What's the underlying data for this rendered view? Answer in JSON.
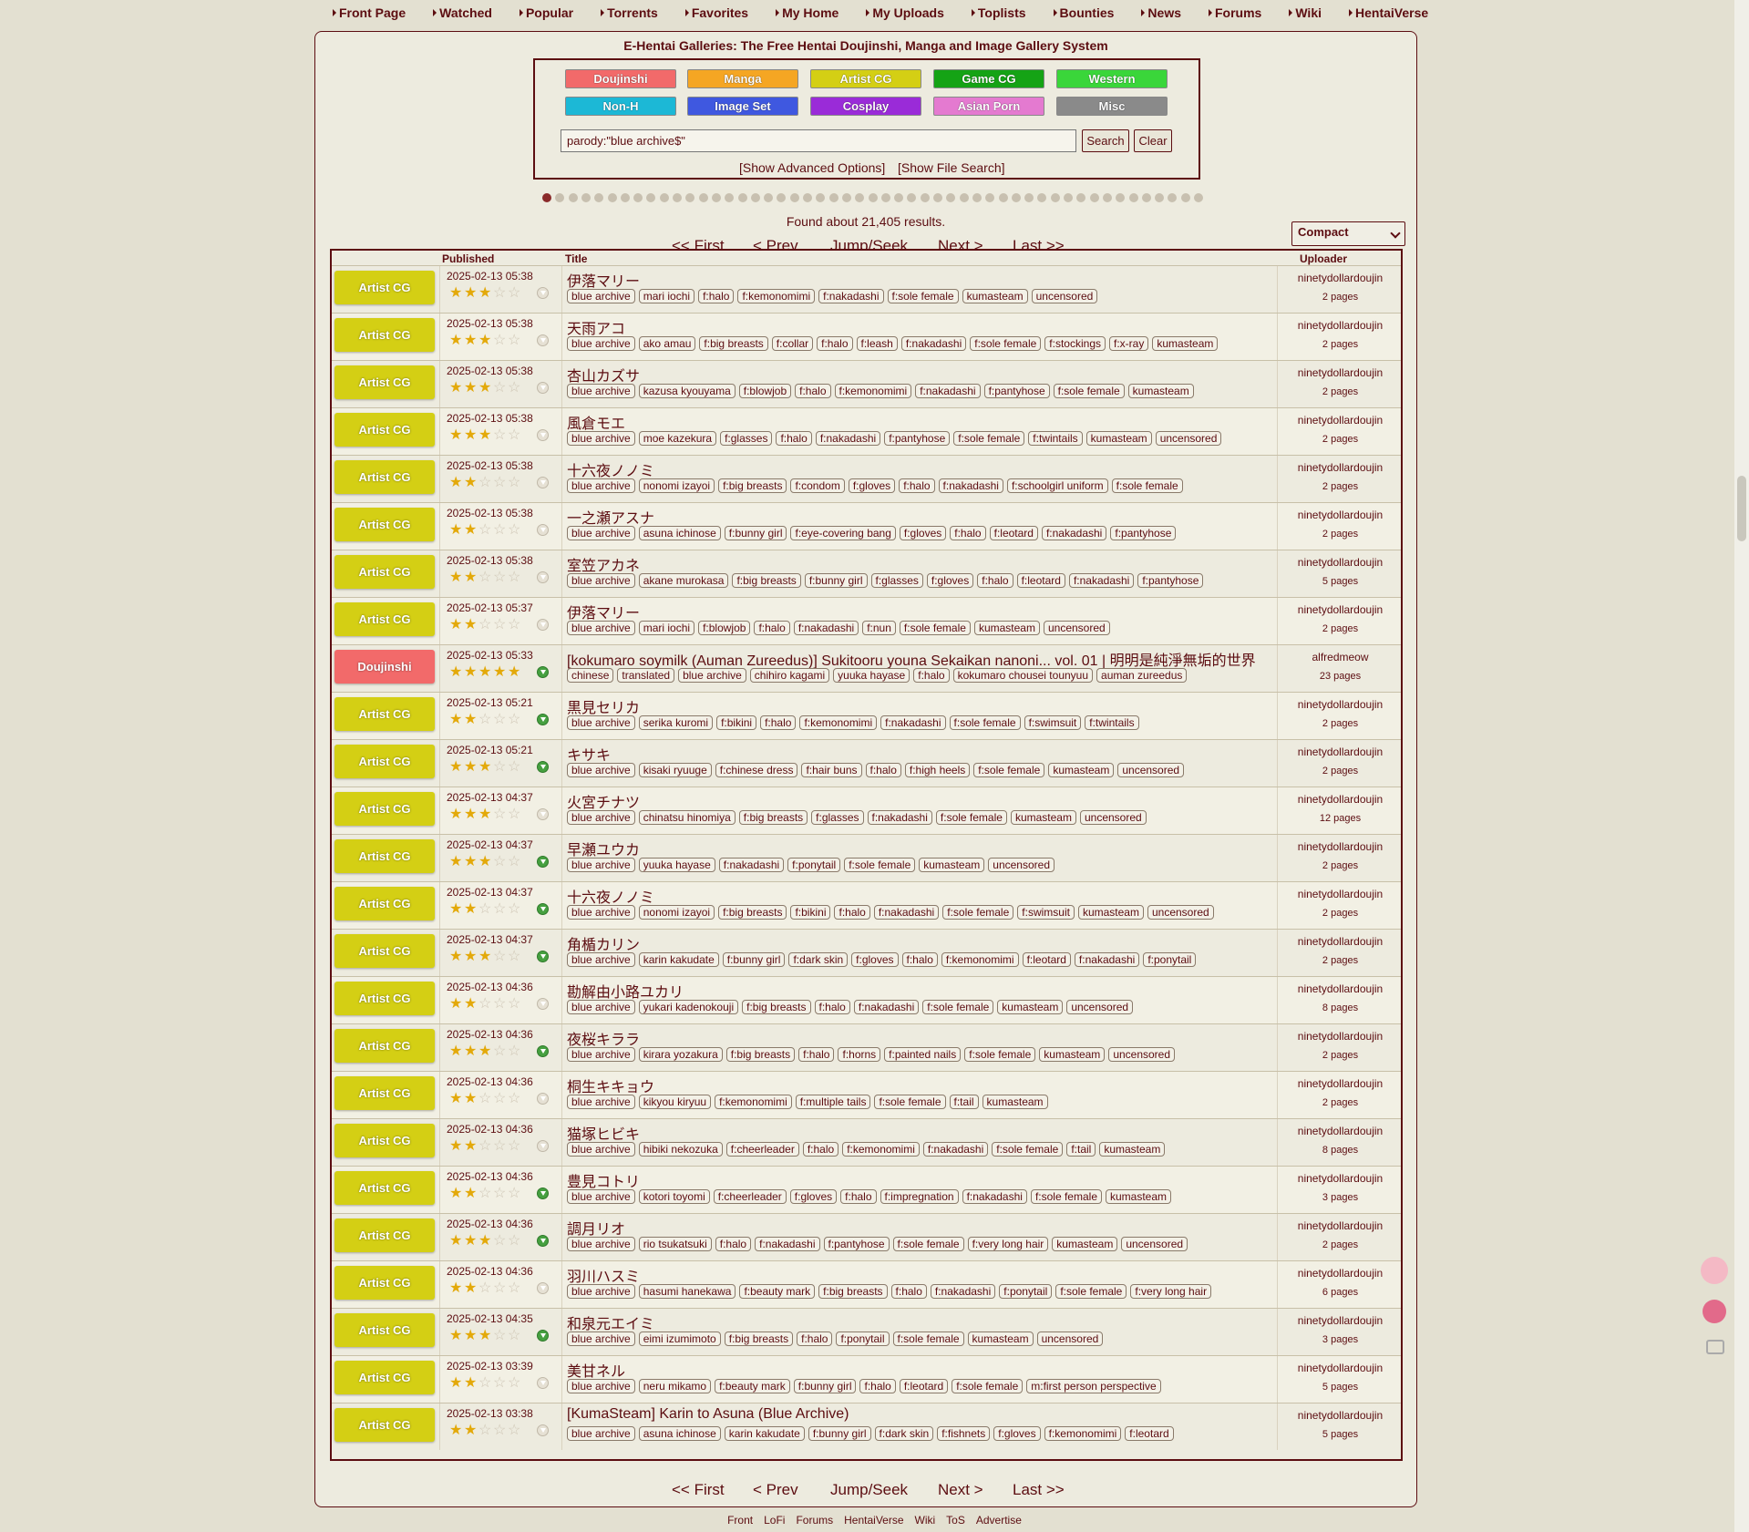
{
  "nav": [
    "Front Page",
    "Watched",
    "Popular",
    "Torrents",
    "Favorites",
    "My Home",
    "My Uploads",
    "Toplists",
    "Bounties",
    "News",
    "Forums",
    "Wiki",
    "HentaiVerse"
  ],
  "site_title": "E-Hentai Galleries: The Free Hentai Doujinshi, Manga and Image Gallery System",
  "categories": [
    {
      "label": "Doujinshi",
      "color": "#f26a6a"
    },
    {
      "label": "Manga",
      "color": "#f5a623"
    },
    {
      "label": "Artist CG",
      "color": "#d4cf14"
    },
    {
      "label": "Game CG",
      "color": "#15a315"
    },
    {
      "label": "Western",
      "color": "#3ad63a"
    },
    {
      "label": "Non-H",
      "color": "#1cb8d6"
    },
    {
      "label": "Image Set",
      "color": "#3f58e0"
    },
    {
      "label": "Cosplay",
      "color": "#9a2bd8"
    },
    {
      "label": "Asian Porn",
      "color": "#e47ad0"
    },
    {
      "label": "Misc",
      "color": "#8a8a8a"
    }
  ],
  "search": {
    "value": "parody:\"blue archive$\"",
    "search_label": "Search",
    "clear_label": "Clear",
    "advanced": "[Show Advanced Options]",
    "file_search": "[Show File Search]"
  },
  "results_text": "Found about 21,405 results.",
  "pager": {
    "first": "<< First",
    "prev": "< Prev",
    "jump": "Jump/Seek",
    "next": "Next >",
    "last": "Last >>"
  },
  "view_mode": "Compact",
  "headers": {
    "published": "Published",
    "title": "Title",
    "uploader": "Uploader"
  },
  "rows": [
    {
      "cat": "Artist CG",
      "date": "2025-02-13 05:38",
      "stars": 2.5,
      "dl": false,
      "title": "伊落マリー",
      "tags": [
        "blue archive",
        "mari iochi",
        "f:halo",
        "f:kemonomimi",
        "f:nakadashi",
        "f:sole female",
        "kumasteam",
        "uncensored"
      ],
      "uploader": "ninetydollardoujin",
      "pages": "2 pages"
    },
    {
      "cat": "Artist CG",
      "date": "2025-02-13 05:38",
      "stars": 2.5,
      "dl": false,
      "title": "天雨アコ",
      "tags": [
        "blue archive",
        "ako amau",
        "f:big breasts",
        "f:collar",
        "f:halo",
        "f:leash",
        "f:nakadashi",
        "f:sole female",
        "f:stockings",
        "f:x-ray",
        "kumasteam"
      ],
      "uploader": "ninetydollardoujin",
      "pages": "2 pages"
    },
    {
      "cat": "Artist CG",
      "date": "2025-02-13 05:38",
      "stars": 2.5,
      "dl": false,
      "title": "杏山カズサ",
      "tags": [
        "blue archive",
        "kazusa kyouyama",
        "f:blowjob",
        "f:halo",
        "f:kemonomimi",
        "f:nakadashi",
        "f:pantyhose",
        "f:sole female",
        "kumasteam"
      ],
      "uploader": "ninetydollardoujin",
      "pages": "2 pages"
    },
    {
      "cat": "Artist CG",
      "date": "2025-02-13 05:38",
      "stars": 2.5,
      "dl": false,
      "title": "風倉モエ",
      "tags": [
        "blue archive",
        "moe kazekura",
        "f:glasses",
        "f:halo",
        "f:nakadashi",
        "f:pantyhose",
        "f:sole female",
        "f:twintails",
        "kumasteam",
        "uncensored"
      ],
      "uploader": "ninetydollardoujin",
      "pages": "2 pages"
    },
    {
      "cat": "Artist CG",
      "date": "2025-02-13 05:38",
      "stars": 2,
      "dl": false,
      "title": "十六夜ノノミ",
      "tags": [
        "blue archive",
        "nonomi izayoi",
        "f:big breasts",
        "f:condom",
        "f:gloves",
        "f:halo",
        "f:nakadashi",
        "f:schoolgirl uniform",
        "f:sole female"
      ],
      "uploader": "ninetydollardoujin",
      "pages": "2 pages"
    },
    {
      "cat": "Artist CG",
      "date": "2025-02-13 05:38",
      "stars": 2,
      "dl": false,
      "title": "一之瀬アスナ",
      "tags": [
        "blue archive",
        "asuna ichinose",
        "f:bunny girl",
        "f:eye-covering bang",
        "f:gloves",
        "f:halo",
        "f:leotard",
        "f:nakadashi",
        "f:pantyhose"
      ],
      "uploader": "ninetydollardoujin",
      "pages": "2 pages"
    },
    {
      "cat": "Artist CG",
      "date": "2025-02-13 05:38",
      "stars": 2,
      "dl": false,
      "title": "室笠アカネ",
      "tags": [
        "blue archive",
        "akane murokasa",
        "f:big breasts",
        "f:bunny girl",
        "f:glasses",
        "f:gloves",
        "f:halo",
        "f:leotard",
        "f:nakadashi",
        "f:pantyhose"
      ],
      "uploader": "ninetydollardoujin",
      "pages": "5 pages"
    },
    {
      "cat": "Artist CG",
      "date": "2025-02-13 05:37",
      "stars": 2,
      "dl": false,
      "title": "伊落マリー",
      "tags": [
        "blue archive",
        "mari iochi",
        "f:blowjob",
        "f:halo",
        "f:nakadashi",
        "f:nun",
        "f:sole female",
        "kumasteam",
        "uncensored"
      ],
      "uploader": "ninetydollardoujin",
      "pages": "2 pages"
    },
    {
      "cat": "Doujinshi",
      "date": "2025-02-13 05:33",
      "stars": 4.5,
      "dl": true,
      "title": "[kokumaro soymilk (Auman Zureedus)] Sukitooru youna Sekaikan nanoni... vol. 01 | 明明是純淨無垢的世界",
      "tags": [
        "chinese",
        "translated",
        "blue archive",
        "chihiro kagami",
        "yuuka hayase",
        "f:halo",
        "kokumaro chousei tounyuu",
        "auman zureedus"
      ],
      "uploader": "alfredmeow",
      "pages": "23 pages"
    },
    {
      "cat": "Artist CG",
      "date": "2025-02-13 05:21",
      "stars": 2,
      "dl": true,
      "title": "黒見セリカ",
      "tags": [
        "blue archive",
        "serika kuromi",
        "f:bikini",
        "f:halo",
        "f:kemonomimi",
        "f:nakadashi",
        "f:sole female",
        "f:swimsuit",
        "f:twintails"
      ],
      "uploader": "ninetydollardoujin",
      "pages": "2 pages"
    },
    {
      "cat": "Artist CG",
      "date": "2025-02-13 05:21",
      "stars": 2.5,
      "dl": true,
      "title": "キサキ",
      "tags": [
        "blue archive",
        "kisaki ryuuge",
        "f:chinese dress",
        "f:hair buns",
        "f:halo",
        "f:high heels",
        "f:sole female",
        "kumasteam",
        "uncensored"
      ],
      "uploader": "ninetydollardoujin",
      "pages": "2 pages"
    },
    {
      "cat": "Artist CG",
      "date": "2025-02-13 04:37",
      "stars": 2.5,
      "dl": false,
      "title": "火宮チナツ",
      "tags": [
        "blue archive",
        "chinatsu hinomiya",
        "f:big breasts",
        "f:glasses",
        "f:nakadashi",
        "f:sole female",
        "kumasteam",
        "uncensored"
      ],
      "uploader": "ninetydollardoujin",
      "pages": "12 pages"
    },
    {
      "cat": "Artist CG",
      "date": "2025-02-13 04:37",
      "stars": 2.5,
      "dl": true,
      "title": "早瀬ユウカ",
      "tags": [
        "blue archive",
        "yuuka hayase",
        "f:nakadashi",
        "f:ponytail",
        "f:sole female",
        "kumasteam",
        "uncensored"
      ],
      "uploader": "ninetydollardoujin",
      "pages": "2 pages"
    },
    {
      "cat": "Artist CG",
      "date": "2025-02-13 04:37",
      "stars": 2,
      "dl": true,
      "title": "十六夜ノノミ",
      "tags": [
        "blue archive",
        "nonomi izayoi",
        "f:big breasts",
        "f:bikini",
        "f:halo",
        "f:nakadashi",
        "f:sole female",
        "f:swimsuit",
        "kumasteam",
        "uncensored"
      ],
      "uploader": "ninetydollardoujin",
      "pages": "2 pages"
    },
    {
      "cat": "Artist CG",
      "date": "2025-02-13 04:37",
      "stars": 2.5,
      "dl": true,
      "title": "角楯カリン",
      "tags": [
        "blue archive",
        "karin kakudate",
        "f:bunny girl",
        "f:dark skin",
        "f:gloves",
        "f:halo",
        "f:kemonomimi",
        "f:leotard",
        "f:nakadashi",
        "f:ponytail"
      ],
      "uploader": "ninetydollardoujin",
      "pages": "2 pages"
    },
    {
      "cat": "Artist CG",
      "date": "2025-02-13 04:36",
      "stars": 2,
      "dl": false,
      "title": "勘解由小路ユカリ",
      "tags": [
        "blue archive",
        "yukari kadenokouji",
        "f:big breasts",
        "f:halo",
        "f:nakadashi",
        "f:sole female",
        "kumasteam",
        "uncensored"
      ],
      "uploader": "ninetydollardoujin",
      "pages": "8 pages"
    },
    {
      "cat": "Artist CG",
      "date": "2025-02-13 04:36",
      "stars": 2.5,
      "dl": true,
      "title": "夜桜キララ",
      "tags": [
        "blue archive",
        "kirara yozakura",
        "f:big breasts",
        "f:halo",
        "f:horns",
        "f:painted nails",
        "f:sole female",
        "kumasteam",
        "uncensored"
      ],
      "uploader": "ninetydollardoujin",
      "pages": "2 pages"
    },
    {
      "cat": "Artist CG",
      "date": "2025-02-13 04:36",
      "stars": 2,
      "dl": false,
      "title": "桐生キキョウ",
      "tags": [
        "blue archive",
        "kikyou kiryuu",
        "f:kemonomimi",
        "f:multiple tails",
        "f:sole female",
        "f:tail",
        "kumasteam"
      ],
      "uploader": "ninetydollardoujin",
      "pages": "2 pages"
    },
    {
      "cat": "Artist CG",
      "date": "2025-02-13 04:36",
      "stars": 2,
      "dl": false,
      "title": "猫塚ヒビキ",
      "tags": [
        "blue archive",
        "hibiki nekozuka",
        "f:cheerleader",
        "f:halo",
        "f:kemonomimi",
        "f:nakadashi",
        "f:sole female",
        "f:tail",
        "kumasteam"
      ],
      "uploader": "ninetydollardoujin",
      "pages": "8 pages"
    },
    {
      "cat": "Artist CG",
      "date": "2025-02-13 04:36",
      "stars": 2,
      "dl": true,
      "title": "豊見コトリ",
      "tags": [
        "blue archive",
        "kotori toyomi",
        "f:cheerleader",
        "f:gloves",
        "f:halo",
        "f:impregnation",
        "f:nakadashi",
        "f:sole female",
        "kumasteam"
      ],
      "uploader": "ninetydollardoujin",
      "pages": "3 pages"
    },
    {
      "cat": "Artist CG",
      "date": "2025-02-13 04:36",
      "stars": 2.5,
      "dl": true,
      "title": "調月リオ",
      "tags": [
        "blue archive",
        "rio tsukatsuki",
        "f:halo",
        "f:nakadashi",
        "f:pantyhose",
        "f:sole female",
        "f:very long hair",
        "kumasteam",
        "uncensored"
      ],
      "uploader": "ninetydollardoujin",
      "pages": "2 pages"
    },
    {
      "cat": "Artist CG",
      "date": "2025-02-13 04:36",
      "stars": 2,
      "dl": false,
      "title": "羽川ハスミ",
      "tags": [
        "blue archive",
        "hasumi hanekawa",
        "f:beauty mark",
        "f:big breasts",
        "f:halo",
        "f:nakadashi",
        "f:ponytail",
        "f:sole female",
        "f:very long hair"
      ],
      "uploader": "ninetydollardoujin",
      "pages": "6 pages"
    },
    {
      "cat": "Artist CG",
      "date": "2025-02-13 04:35",
      "stars": 2.5,
      "dl": true,
      "title": "和泉元エイミ",
      "tags": [
        "blue archive",
        "eimi izumimoto",
        "f:big breasts",
        "f:halo",
        "f:ponytail",
        "f:sole female",
        "kumasteam",
        "uncensored"
      ],
      "uploader": "ninetydollardoujin",
      "pages": "3 pages"
    },
    {
      "cat": "Artist CG",
      "date": "2025-02-13 03:39",
      "stars": 2,
      "dl": false,
      "title": "美甘ネル",
      "tags": [
        "blue archive",
        "neru mikamo",
        "f:beauty mark",
        "f:bunny girl",
        "f:halo",
        "f:leotard",
        "f:sole female",
        "m:first person perspective"
      ],
      "uploader": "ninetydollardoujin",
      "pages": "5 pages"
    },
    {
      "cat": "Artist CG",
      "date": "2025-02-13 03:38",
      "stars": 1.5,
      "dl": false,
      "title": "[KumaSteam] Karin to Asuna (Blue Archive)",
      "tags": [
        "blue archive",
        "asuna ichinose",
        "karin kakudate",
        "f:bunny girl",
        "f:dark skin",
        "f:fishnets",
        "f:gloves",
        "f:kemonomimi",
        "f:leotard"
      ],
      "uploader": "ninetydollardoujin",
      "pages": "5 pages"
    }
  ],
  "footer": [
    "Front",
    "LoFi",
    "Forums",
    "HentaiVerse",
    "Wiki",
    "ToS",
    "Advertise"
  ]
}
